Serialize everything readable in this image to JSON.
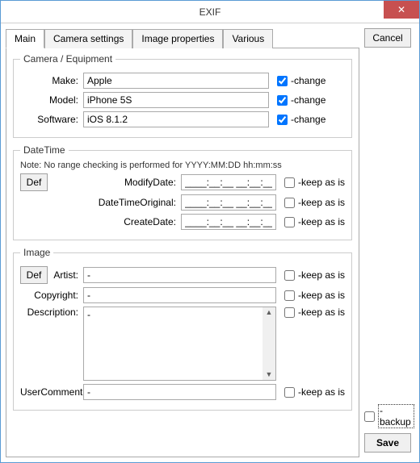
{
  "window": {
    "title": "EXIF"
  },
  "buttons": {
    "close": "✕",
    "cancel": "Cancel",
    "save": "Save",
    "def": "Def",
    "backup_label": "-backup"
  },
  "tabs": [
    "Main",
    "Camera settings",
    "Image properties",
    "Various"
  ],
  "camera_group": {
    "legend": "Camera / Equipment",
    "make_label": "Make:",
    "make_value": "Apple",
    "model_label": "Model:",
    "model_value": "iPhone 5S",
    "software_label": "Software:",
    "software_value": "iOS 8.1.2",
    "change_label": "-change"
  },
  "datetime_group": {
    "legend": "DateTime",
    "note": "Note: No range checking is performed for YYYY:MM:DD hh:mm:ss",
    "modify_label": "ModifyDate:",
    "original_label": "DateTimeOriginal:",
    "create_label": "CreateDate:",
    "dt_value": "____:__:__ __:__:__",
    "keep_label": "-keep as is"
  },
  "image_group": {
    "legend": "Image",
    "artist_label": "Artist:",
    "artist_value": "-",
    "copyright_label": "Copyright:",
    "copyright_value": "-",
    "description_label": "Description:",
    "description_value": "-",
    "usercomment_label": "UserComment:",
    "usercomment_value": "-",
    "keep_label": "-keep as is"
  }
}
